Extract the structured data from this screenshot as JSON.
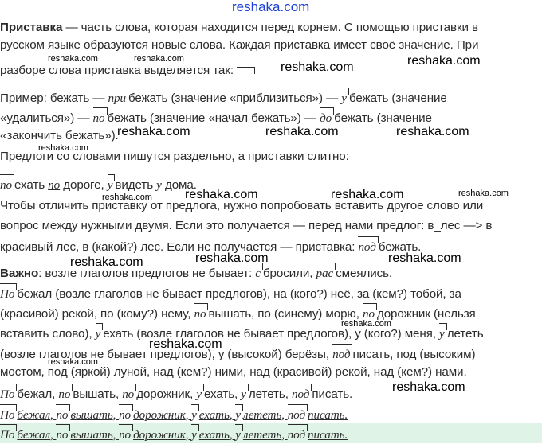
{
  "watermark": "reshaka.com",
  "intro": {
    "term": "Приставка",
    "l1": " — часть слова, которая находится перед корнем. С помощью приставки в",
    "l2": "русском языке образуются новые слова. Каждая приставка имеет своё значение. При",
    "l3": "разборе слова приставка выделяется так:"
  },
  "example": {
    "l1a": "Пример: бежать — ",
    "p1": "при",
    "l1b": "бежать (значение «приблизиться») — ",
    "p2": "у",
    "l1c": "бежать (значение",
    "l2a": "«удалиться») — ",
    "p3": "по",
    "l2b": "бежать (значение «начал бежать») — ",
    "p4": "до",
    "l2c": "бежать (значение",
    "l3": "«закончить бежать»)."
  },
  "prepositions": {
    "rule": "Предлоги со словами пишутся раздельно, а приставки слитно:",
    "p1": "по",
    "w1": "ехать ",
    "prep1": "по",
    "w2": " дороге, ",
    "p2": "у",
    "w3": "видеть ",
    "prep2": "у",
    "w4": " дома."
  },
  "distinguish": {
    "l1": "Чтобы отличить приставку от предлога, нужно попробовать вставить другое слово или",
    "l2": "вопрос между нужными двумя. Если это получается — перед нами предлог: в_лес —> в",
    "l3a": "красивый лес, в (какой?) лес. Если не получается — приставка: ",
    "p": "под",
    "l3b": "бежать."
  },
  "important": {
    "label": "Важно",
    "l1a": ": возле глаголов предлогов не бывает: ",
    "p1": "с",
    "l1b": "бросили, ",
    "p2": "рас",
    "l1c": "смеялись.",
    "l2p": "По",
    "l2": "бежал (возле глаголов не бывает предлогов), на (кого?) неё, за (кем?) тобой, за",
    "l3a": "(красивой) рекой, по (кому?) нему, ",
    "l3p": "по",
    "l3b": "вышать, по (синему) морю, ",
    "l3p2": "по",
    "l3c": "дорожник (нельзя",
    "l4a": "вставить слово), ",
    "l4p": "у",
    "l4b": "ехать (возле глаголов не бывает предлогов), у (кого?) меня, ",
    "l4p2": "у",
    "l4c": "лететь",
    "l5a": "(возле глаголов не бывает предлогов), у (высокой) берёзы, ",
    "l5p": "под",
    "l5b": "писать, под (высоким)",
    "l6": "мостом, под (яркой) луной, над (кем?) ними, над (красивой) рекой, над (кем?) нами."
  },
  "summary": {
    "p1": "По",
    "w1": "бежал, ",
    "p2": "по",
    "w2": "вышать, ",
    "p3": "по",
    "w3": "дорожник, ",
    "p4": "у",
    "w4": "ехать, ",
    "p5": "у",
    "w5": "лететь, ",
    "p6": "под",
    "w6": "писать."
  },
  "summary_italic": {
    "p1": "По",
    "w1": "бежал",
    "p2": "по",
    "w2": "вышать",
    "p3": "по",
    "w3": "дорожник",
    "p4": "у",
    "w4": "ехать",
    "p5": "у",
    "w5": "лететь",
    "p6": "под",
    "w6": "писать"
  },
  "colors": {
    "text": "#2b2b2b",
    "watermark_top": "#1a3fd6",
    "final_band": "#dff3e6"
  }
}
